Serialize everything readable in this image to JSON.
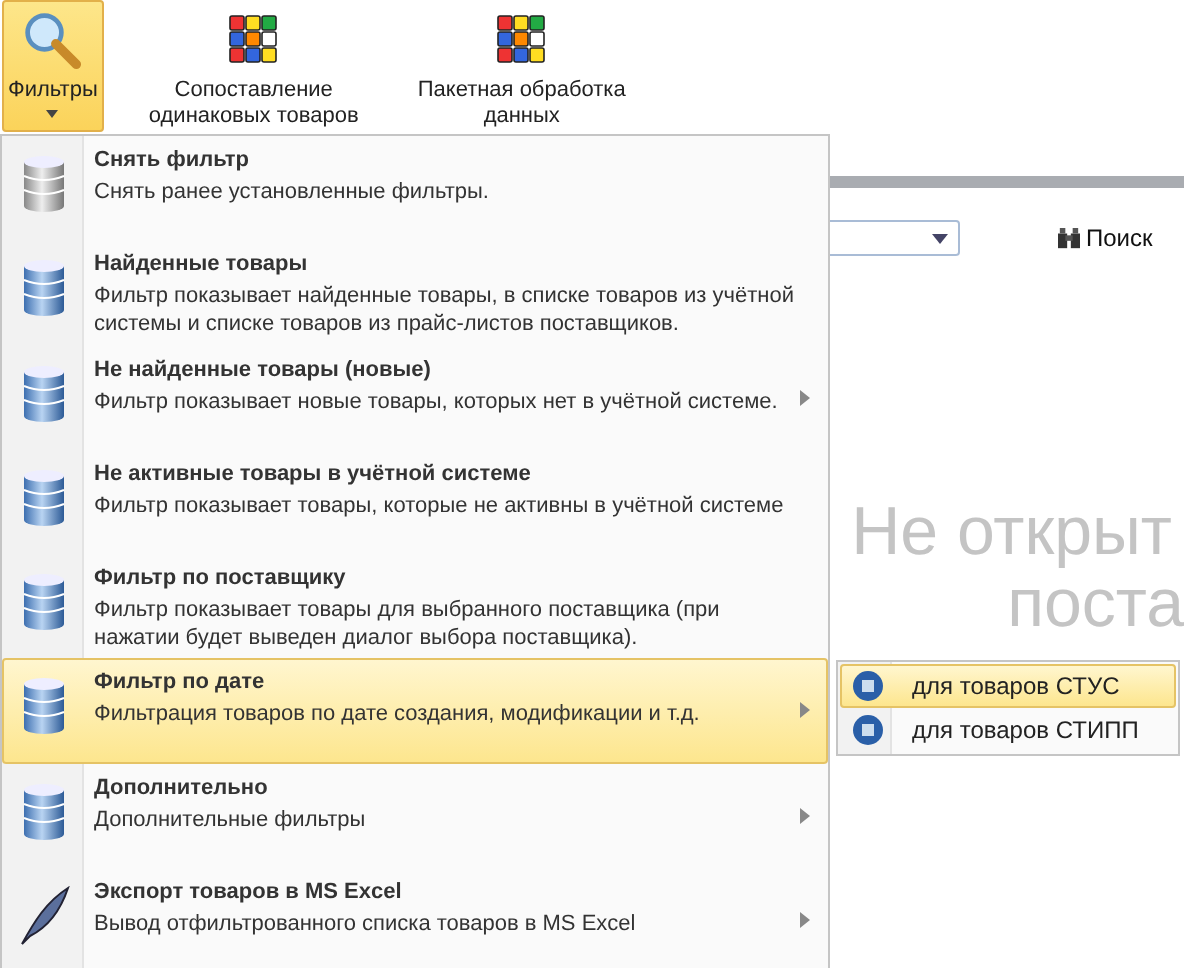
{
  "ribbon": {
    "buttons": [
      {
        "label": "Фильтры",
        "kind": "search",
        "selected": true
      },
      {
        "label": "Сопоставление одинаковых товаров",
        "kind": "cube",
        "selected": false
      },
      {
        "label": "Пакетная обработка данных",
        "kind": "cube",
        "selected": false
      }
    ]
  },
  "menu": {
    "items": [
      {
        "title": "Снять фильтр",
        "description": "Снять ранее установленные фильтры.",
        "kind": "disk",
        "submenu": false,
        "selected": false
      },
      {
        "title": "Найденные товары",
        "description": "Фильтр показывает найденные товары, в списке товаров из учётной системы и списке товаров из прайс-листов поставщиков.",
        "kind": "database",
        "submenu": false,
        "selected": false
      },
      {
        "title": "Не найденные товары (новые)",
        "description": "Фильтр показывает новые товары, которых нет в учётной системе.",
        "kind": "database",
        "submenu": true,
        "selected": false
      },
      {
        "title": "Не активные товары в учётной системе",
        "description": "Фильтр показывает товары, которые не активны в учётной системе",
        "kind": "database",
        "submenu": false,
        "selected": false
      },
      {
        "title": "Фильтр по поставщику",
        "description": "Фильтр показывает товары для выбранного поставщика (при нажатии будет выведен диалог выбора поставщика).",
        "kind": "database",
        "submenu": false,
        "selected": false
      },
      {
        "title": "Фильтр по дате",
        "description": "Фильтрация товаров по дате создания, модификации и т.д.",
        "kind": "database",
        "submenu": true,
        "selected": true
      },
      {
        "title": "Дополнительно",
        "description": "Дополнительные фильтры",
        "kind": "database",
        "submenu": true,
        "selected": false
      },
      {
        "title": "Экспорт товаров в MS Excel",
        "description": "Вывод отфильтрованного списка товаров в MS Excel",
        "kind": "feather",
        "submenu": true,
        "selected": false
      }
    ]
  },
  "submenu": {
    "items": [
      {
        "label": "для товаров СТУС",
        "selected": true
      },
      {
        "label": "для товаров СТИПП",
        "selected": false
      }
    ]
  },
  "search_button": {
    "label": "Поиск"
  },
  "empty_message": {
    "lines": [
      "Не открыт",
      "поста"
    ]
  }
}
